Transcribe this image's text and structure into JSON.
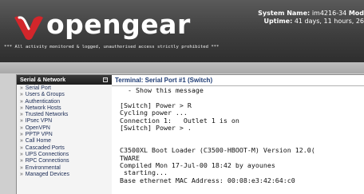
{
  "header": {
    "brand": "opengear",
    "system_name_label": "System Name:",
    "system_name_value": "im4216-34",
    "system_name_extra": "Mod",
    "uptime_label": "Uptime:",
    "uptime_value": "41 days, 11 hours, 26",
    "warning": "*** All activity monitored & logged, unauthorised access strictly prohibited ***"
  },
  "sidebar": {
    "title": "Serial & Network",
    "items": [
      "Serial Port",
      "Users & Groups",
      "Authentication",
      "Network Hosts",
      "Trusted Networks",
      "IPsec VPN",
      "OpenVPN",
      "PPTP VPN",
      "Call Home",
      "Cascaded Ports",
      "UPS Connections",
      "RPC Connections",
      "Environmental",
      "Managed Devices"
    ]
  },
  "terminal": {
    "title": "Terminal: Serial Port #1 (Switch)",
    "lines": [
      "  - Show this message",
      "",
      "[Switch] Power > R",
      "Cycling power ...",
      "Connection 1:   Outlet 1 is on",
      "[Switch] Power > .",
      "",
      "",
      "C3500XL Boot Loader (C3500-HBOOT-M) Version 12.0(",
      "TWARE",
      "Compiled Mon 17-Jul-00 18:42 by ayounes",
      " starting...",
      "Base ethernet MAC Address: 00:08:e3:42:64:c0"
    ]
  },
  "colors": {
    "header_bg": "#3e3e3e",
    "logo_red": "#d3262b",
    "link_blue": "#1a2b55",
    "title_blue": "#1d3a72"
  }
}
